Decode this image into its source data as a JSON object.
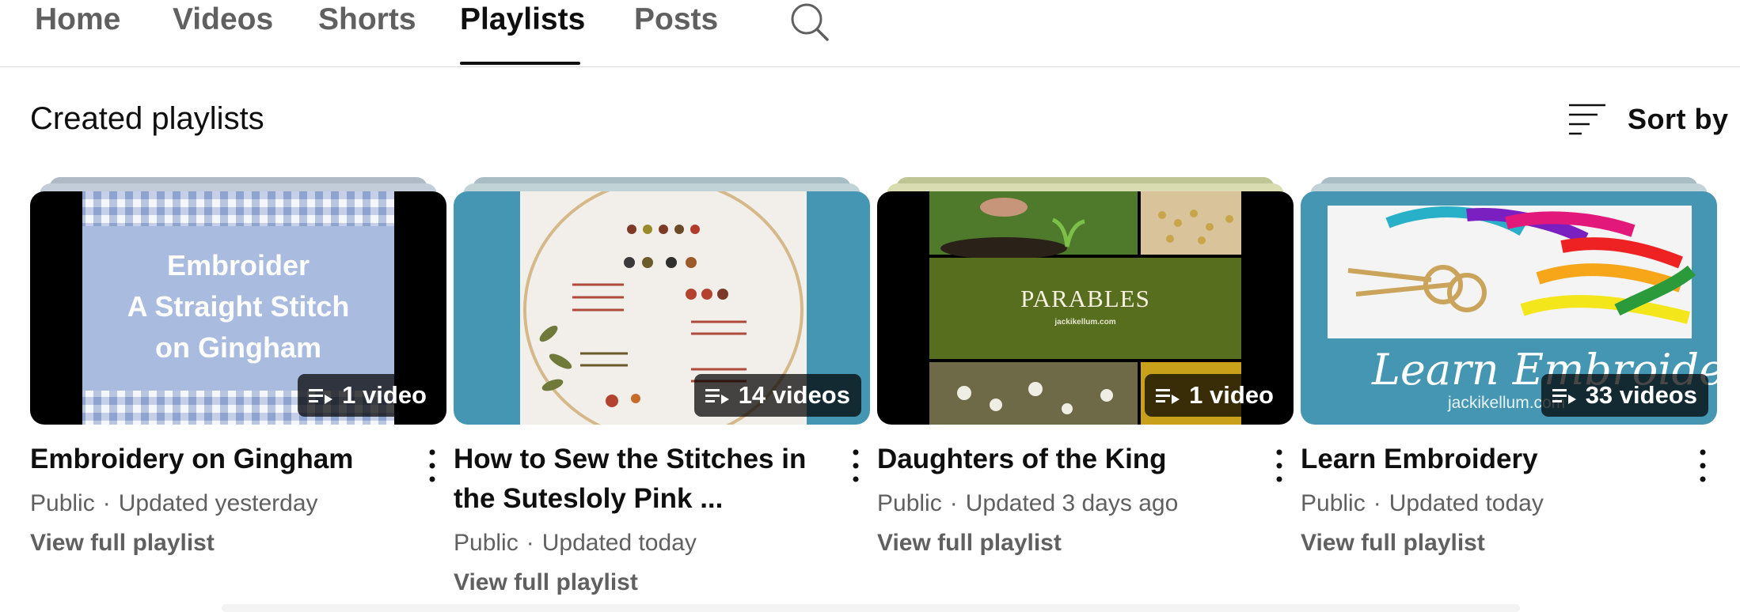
{
  "tabs": [
    {
      "label": "Home"
    },
    {
      "label": "Videos"
    },
    {
      "label": "Shorts"
    },
    {
      "label": "Playlists",
      "active": true
    },
    {
      "label": "Posts"
    }
  ],
  "section": {
    "title": "Created playlists",
    "sort_label": "Sort by"
  },
  "playlists": [
    {
      "title": "Embroidery on Gingham",
      "title_line2": "",
      "visibility": "Public",
      "updated": "Updated yesterday",
      "count": "1 video",
      "view_label": "View full playlist",
      "thumb_text": [
        "Embroider",
        "A Straight Stitch",
        "on Gingham"
      ]
    },
    {
      "title": "How to Sew the Stitches in",
      "title_line2": "the Sutesloly Pink ...",
      "visibility": "Public",
      "updated": "Updated today",
      "count": "14 videos",
      "view_label": "View full playlist"
    },
    {
      "title": "Daughters of the King",
      "title_line2": "",
      "visibility": "Public",
      "updated": "Updated 3 days ago",
      "count": "1 video",
      "view_label": "View full playlist",
      "thumb_text": [
        "PARABLES",
        "jackikellum.com"
      ]
    },
    {
      "title": "Learn Embroidery",
      "title_line2": "",
      "visibility": "Public",
      "updated": "Updated today",
      "count": "33 videos",
      "view_label": "View full playlist",
      "thumb_text": [
        "Learn Embroidery",
        "jackikellum.com"
      ]
    }
  ],
  "icons": {
    "search": "search-icon",
    "sort": "sort-icon",
    "playlist": "playlist-icon",
    "more": "more-vertical-icon"
  },
  "colors": {
    "active_tab": "#0f0f0f",
    "inactive_tab": "#606060",
    "badge_bg": "#000000b8",
    "teal": "#4596b2"
  }
}
